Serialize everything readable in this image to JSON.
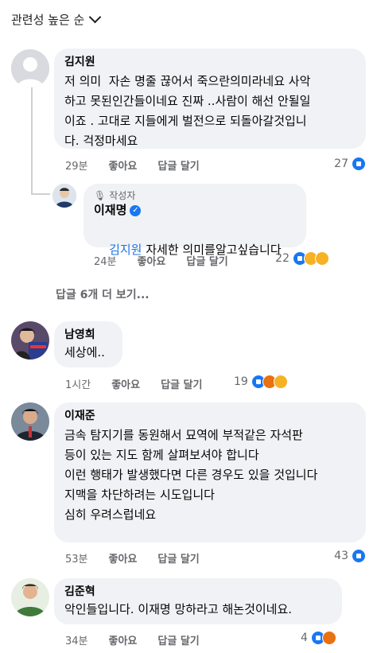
{
  "sort": {
    "label": "관련성 높은 순"
  },
  "comments": [
    {
      "name": "김지원",
      "text": "저 의미  자손 명줄 끊어서 죽으란의미라네요 사악\n하고 못된인간들이네요 진짜 ..사람이 해선 안될일\n이죠 . 고대로 지들에게 벌전으로 되돌아갈것입니\n다. 걱정마세요",
      "time": "29분",
      "like_label": "좋아요",
      "reply_label": "답글 달기",
      "reaction_count": "27"
    },
    {
      "author_tag": "작성자",
      "name": "이재명",
      "mention": "김지원",
      "text": " 자세한 의미를알고싶습니다",
      "time": "24분",
      "like_label": "좋아요",
      "reply_label": "답글 달기",
      "reaction_count": "22"
    },
    {
      "name": "남영희",
      "text": "세상에..",
      "time": "1시간",
      "like_label": "좋아요",
      "reply_label": "답글 달기",
      "reaction_count": "19"
    },
    {
      "name": "이재준",
      "text": "금속 탐지기를 동원해서 묘역에 부적같은 자석판\n등이 있는 지도 함께 살펴보셔야 합니다\n이런 행태가 발생했다면 다른 경우도 있을 것입니다\n지맥을 차단하려는 시도입니다\n심히 우려스럽네요",
      "time": "53분",
      "like_label": "좋아요",
      "reply_label": "답글 달기",
      "reaction_count": "43"
    },
    {
      "name": "김준혁",
      "text": "악인들입니다. 이재명 망하라고 해논것이네요.",
      "time": "34분",
      "like_label": "좋아요",
      "reply_label": "답글 달기",
      "reaction_count": "4"
    }
  ],
  "more_replies": "답글 6개 더 보기...",
  "colors": {
    "bubble": "#f0f2f5",
    "link": "#1b74e4",
    "like": "#1877f2",
    "meta": "#65676b"
  }
}
